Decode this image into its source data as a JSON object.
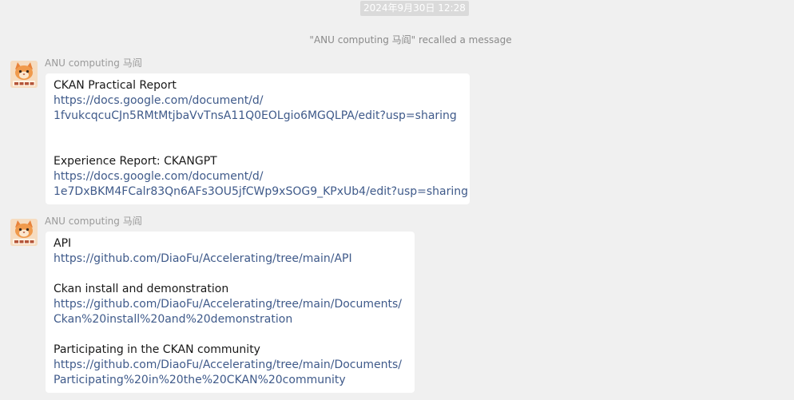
{
  "timestamp": "2024年9月30日 12:28",
  "recall_notice": "\"ANU computing 马阎\" recalled a message",
  "colors": {
    "background": "#f0f0f0",
    "bubble": "#ffffff",
    "link": "#3f5a8a"
  },
  "messages": [
    {
      "sender": "ANU computing 马阎",
      "avatar_icon": "cartoon-cat-avatar-icon",
      "lines": [
        {
          "text": "CKAN Practical Report",
          "type": "text"
        },
        {
          "text": "https://docs.google.com/document/d/",
          "type": "link"
        },
        {
          "text": "1fvukcqcuCJn5RMtMtjbaVvTnsA11Q0EOLgio6MGQLPA/edit?usp=sharing",
          "type": "link"
        },
        {
          "text": "",
          "type": "blank"
        },
        {
          "text": "",
          "type": "blank"
        },
        {
          "text": "Experience Report: CKANGPT",
          "type": "text"
        },
        {
          "text": "https://docs.google.com/document/d/",
          "type": "link"
        },
        {
          "text": "1e7DxBKM4FCalr83Qn6AFs3OU5jfCWp9xSOG9_KPxUb4/edit?usp=sharing",
          "type": "link"
        }
      ]
    },
    {
      "sender": "ANU computing 马阎",
      "avatar_icon": "cartoon-cat-avatar-icon",
      "lines": [
        {
          "text": "API",
          "type": "text"
        },
        {
          "text": "https://github.com/DiaoFu/Accelerating/tree/main/API",
          "type": "link"
        },
        {
          "text": "",
          "type": "blank"
        },
        {
          "text": "Ckan install and demonstration",
          "type": "text"
        },
        {
          "text": "https://github.com/DiaoFu/Accelerating/tree/main/Documents/",
          "type": "link"
        },
        {
          "text": "Ckan%20install%20and%20demonstration",
          "type": "link"
        },
        {
          "text": "",
          "type": "blank"
        },
        {
          "text": "Participating in the CKAN community",
          "type": "text"
        },
        {
          "text": "https://github.com/DiaoFu/Accelerating/tree/main/Documents/",
          "type": "link"
        },
        {
          "text": "Participating%20in%20the%20CKAN%20community",
          "type": "link"
        }
      ]
    }
  ]
}
